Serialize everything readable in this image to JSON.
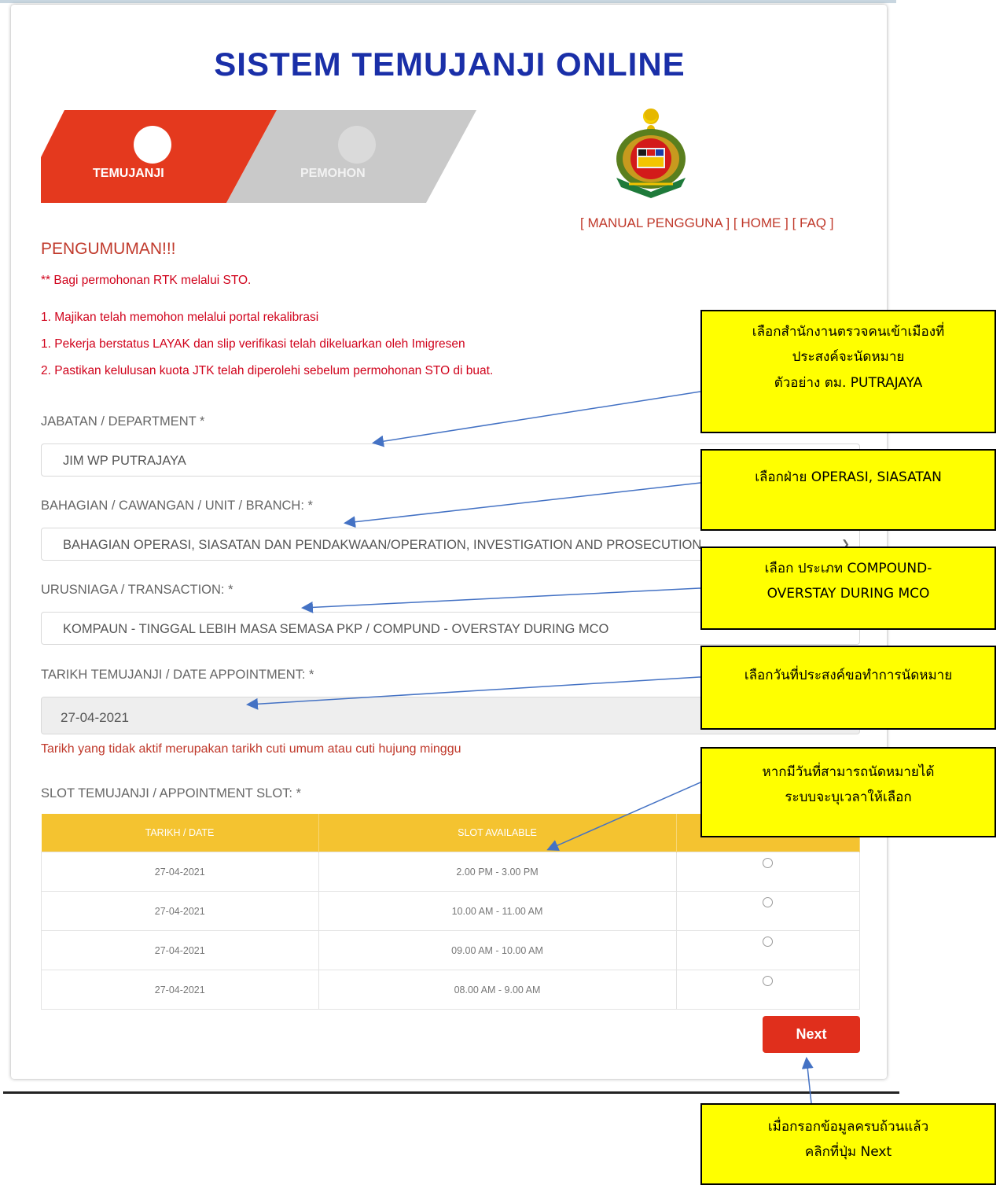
{
  "page": {
    "title": "SISTEM TEMUJANJI ONLINE"
  },
  "wizard": {
    "step1": "TEMUJANJI",
    "step2": "PEMOHON"
  },
  "links": {
    "manual": "[ MANUAL PENGGUNA ]",
    "home": "[ HOME ]",
    "faq": "[ FAQ ]"
  },
  "announcement": {
    "heading": "PENGUMUMAN!!!",
    "lines": [
      "** Bagi permohonan RTK melalui STO.",
      "1. Majikan telah memohon melalui portal rekalibrasi",
      "1. Pekerja berstatus LAYAK dan slip verifikasi telah dikeluarkan oleh Imigresen",
      "2. Pastikan kelulusan kuota JTK telah diperolehi sebelum permohonan STO di buat."
    ]
  },
  "form": {
    "department_label": "JABATAN / DEPARTMENT *",
    "department_value": "JIM WP PUTRAJAYA",
    "branch_label": "BAHAGIAN / CAWANGAN / UNIT / BRANCH: *",
    "branch_value": "BAHAGIAN OPERASI, SIASATAN DAN PENDAKWAAN/OPERATION, INVESTIGATION AND PROSECUTION",
    "transaction_label": "URUSNIAGA / TRANSACTION: *",
    "transaction_value": "KOMPAUN - TINGGAL LEBIH MASA SEMASA PKP / COMPUND - OVERSTAY DURING MCO",
    "date_label": "TARIKH TEMUJANJI / DATE APPOINTMENT: *",
    "date_value": "27-04-2021",
    "date_hint": "Tarikh yang tidak aktif merupakan tarikh cuti umum atau cuti hujung minggu",
    "slot_label": "SLOT TEMUJANJI / APPOINTMENT SLOT: *"
  },
  "slot_table": {
    "headers": [
      "TARIKH / DATE",
      "SLOT AVAILABLE"
    ],
    "rows": [
      {
        "date": "27-04-2021",
        "slot": "2.00 PM - 3.00 PM"
      },
      {
        "date": "27-04-2021",
        "slot": "10.00 AM - 11.00 AM"
      },
      {
        "date": "27-04-2021",
        "slot": "09.00 AM - 10.00 AM"
      },
      {
        "date": "27-04-2021",
        "slot": "08.00 AM - 9.00 AM"
      }
    ]
  },
  "buttons": {
    "next": "Next"
  },
  "callouts": {
    "c1": [
      "เลือกสำนักงานตรวจคนเข้าเมืองที่",
      "ประสงค์จะนัดหมาย",
      "ตัวอย่าง ตม. PUTRAJAYA"
    ],
    "c2": [
      "เลือกฝ่าย OPERASI, SIASATAN"
    ],
    "c3": [
      "เลือก ประเภท COMPOUND-",
      "OVERSTAY DURING MCO"
    ],
    "c4": [
      "เลือกวันที่ประสงค์ขอทำการนัดหมาย"
    ],
    "c5": [
      "หากมีวันที่สามารถนัดหมายได้",
      "ระบบจะบุเวลาให้เลือก"
    ],
    "c6": [
      "เมื่อกรอกข้อมูลครบถ้วนแล้ว",
      "คลิกที่ปุ่ม Next"
    ]
  },
  "colors": {
    "title": "#1a2fa8",
    "step_active": "#e4391e",
    "step_inactive": "#c9c9c9",
    "table_header": "#f4c330",
    "button": "#e02f1c",
    "callout": "#ffff00",
    "arrow": "#4472c4"
  }
}
